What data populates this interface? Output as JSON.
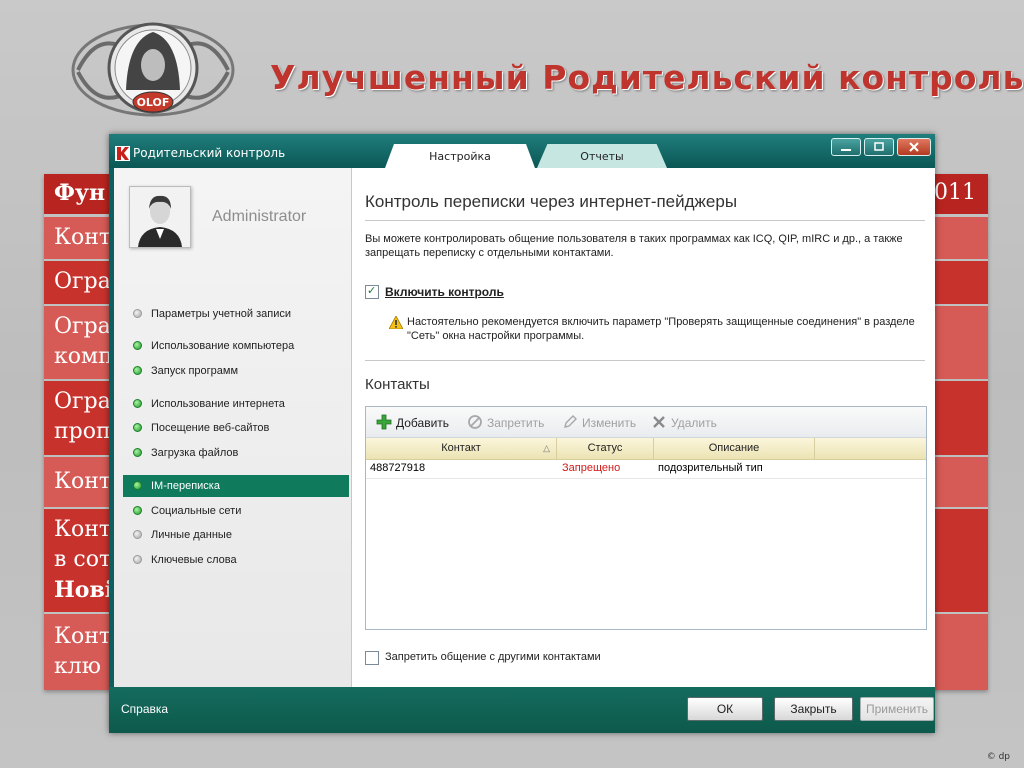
{
  "slide": {
    "title": "Улучшенный Родительский контроль",
    "logo_text": "OLOF",
    "copyright": "© dp",
    "table_rows": [
      {
        "text": "Фун",
        "right": "011"
      },
      {
        "text": "Конт"
      },
      {
        "text": "Огра"
      },
      {
        "text": "Огра",
        "line2": "комп"
      },
      {
        "text": "Огра",
        "line2": "проп"
      },
      {
        "text": "Конт"
      },
      {
        "text": "Конт",
        "line2": "в сот",
        "line3": "Нові"
      },
      {
        "text": "Конт",
        "line2": "клю"
      }
    ]
  },
  "window": {
    "title": "Родительский контроль",
    "tabs": [
      {
        "label": "Настройка",
        "active": true
      },
      {
        "label": "Отчеты",
        "active": false
      }
    ]
  },
  "sidebar": {
    "user_name": "Administrator",
    "items": [
      {
        "label": "Параметры учетной записи",
        "status": "gray"
      },
      {
        "label": "Использование компьютера",
        "status": "green"
      },
      {
        "label": "Запуск программ",
        "status": "green"
      },
      {
        "label": "Использование интернета",
        "status": "green"
      },
      {
        "label": "Посещение веб-сайтов",
        "status": "green"
      },
      {
        "label": "Загрузка файлов",
        "status": "green"
      },
      {
        "label": "IM-переписка",
        "status": "green",
        "selected": true
      },
      {
        "label": "Социальные сети",
        "status": "green"
      },
      {
        "label": "Личные данные",
        "status": "gray"
      },
      {
        "label": "Ключевые слова",
        "status": "gray"
      }
    ]
  },
  "content": {
    "heading": "Контроль переписки через интернет-пейджеры",
    "description": "Вы можете контролировать общение пользователя в таких программах как ICQ, QIP, mIRC и др., а также запрещать переписку с отдельными контактами.",
    "enable_label": "Включить контроль",
    "enable_checked": true,
    "warning_text": "Настоятельно рекомендуется включить параметр \"Проверять защищенные соединения\" в разделе \"Сеть\" окна настройки программы.",
    "contacts_heading": "Контакты",
    "toolbar": {
      "add": "Добавить",
      "block": "Запретить",
      "edit": "Изменить",
      "delete": "Удалить"
    },
    "columns": {
      "contact": "Контакт",
      "status": "Статус",
      "description": "Описание"
    },
    "rows": [
      {
        "contact": "488727918",
        "status": "Запрещено",
        "description": "подозрительный тип"
      }
    ],
    "block_others_label": "Запретить общение с другими контактами",
    "block_others_checked": false
  },
  "footer": {
    "help": "Справка",
    "ok": "ОК",
    "close": "Закрыть",
    "apply": "Применить"
  },
  "colors": {
    "title_red": "#c0342e",
    "window_teal": "#0d5e5e",
    "selected_nav": "#107a5c",
    "forbidden_red": "#d11a1a"
  }
}
